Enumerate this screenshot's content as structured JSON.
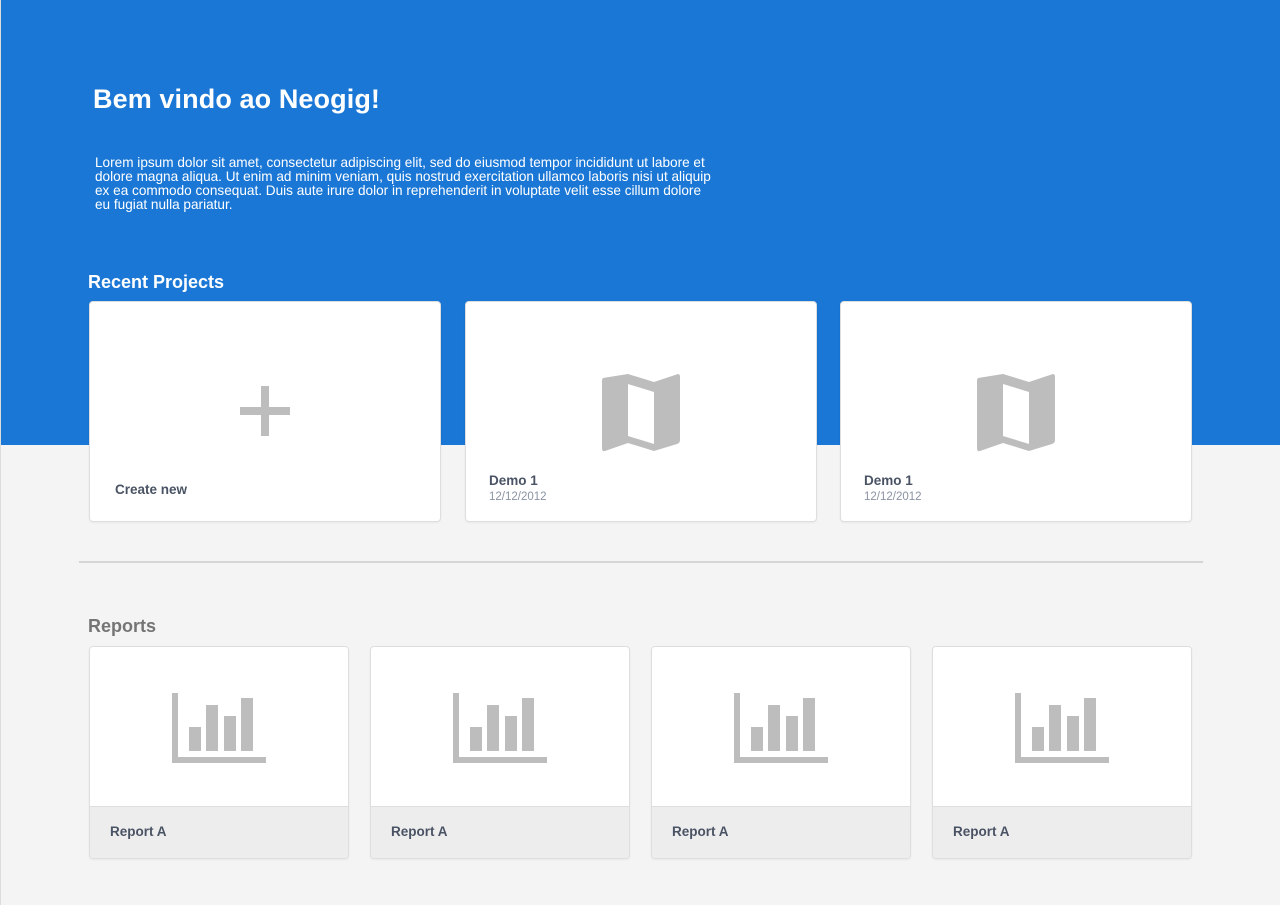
{
  "hero": {
    "title": "Bem vindo ao Neogig!",
    "description": "Lorem ipsum dolor sit amet, consectetur adipiscing elit, sed do eiusmod tempor incididunt ut labore et dolore magna aliqua. Ut enim ad minim veniam, quis nostrud exercitation ullamco laboris nisi ut aliquip ex ea commodo consequat. Duis aute irure dolor in reprehenderit in voluptate velit esse cillum dolore eu fugiat nulla pariatur."
  },
  "recent_projects": {
    "title": "Recent Projects",
    "create_new": {
      "label": "Create new",
      "icon": "plus-icon"
    },
    "items": [
      {
        "name": "Demo 1",
        "date": "12/12/2012",
        "icon": "map-icon"
      },
      {
        "name": "Demo 1",
        "date": "12/12/2012",
        "icon": "map-icon"
      }
    ]
  },
  "reports": {
    "title": "Reports",
    "items": [
      {
        "label": "Report A",
        "icon": "bar-chart-icon"
      },
      {
        "label": "Report A",
        "icon": "bar-chart-icon"
      },
      {
        "label": "Report A",
        "icon": "bar-chart-icon"
      },
      {
        "label": "Report A",
        "icon": "bar-chart-icon"
      }
    ]
  },
  "colors": {
    "hero_background": "#1a77d5",
    "page_background": "#f4f4f4",
    "icon_gray": "#bdbdbd",
    "text_dark": "#4a5364",
    "text_muted": "#8a93a3",
    "reports_title": "#757575"
  }
}
